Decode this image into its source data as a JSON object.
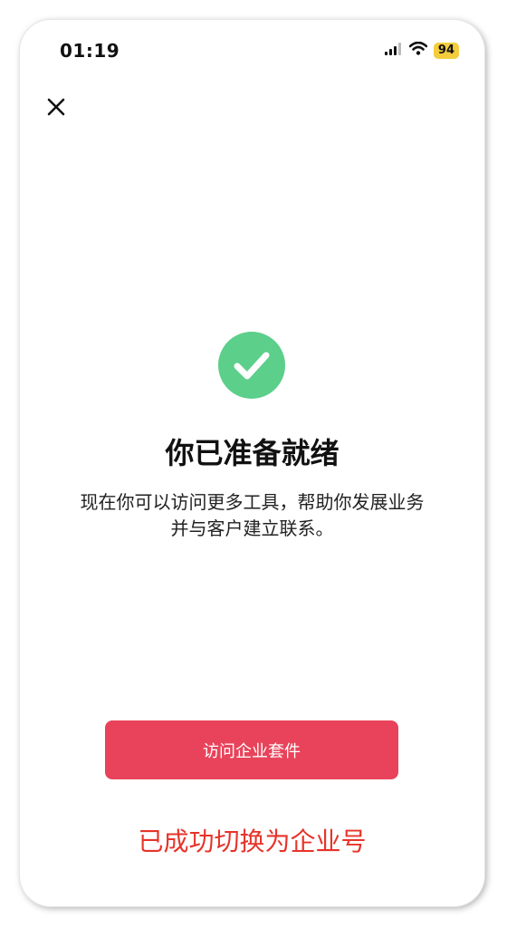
{
  "status_bar": {
    "time": "01:19",
    "battery": "94",
    "icons": [
      "signal-icon",
      "wifi-icon",
      "battery-icon"
    ]
  },
  "header": {
    "close_icon": "close-icon"
  },
  "main": {
    "success_icon": "check-circle-icon",
    "title": "你已准备就绪",
    "description_line1": "现在你可以访问更多工具，帮助你发展业务",
    "description_line2": "并与客户建立联系。",
    "button_label": "访问企业套件"
  },
  "annotation": {
    "text": "已成功切换为企业号"
  },
  "colors": {
    "accent": "#e8435a",
    "success": "#5ccf8a",
    "annotation": "#e6342a",
    "battery_badge": "#f3cd3c"
  }
}
